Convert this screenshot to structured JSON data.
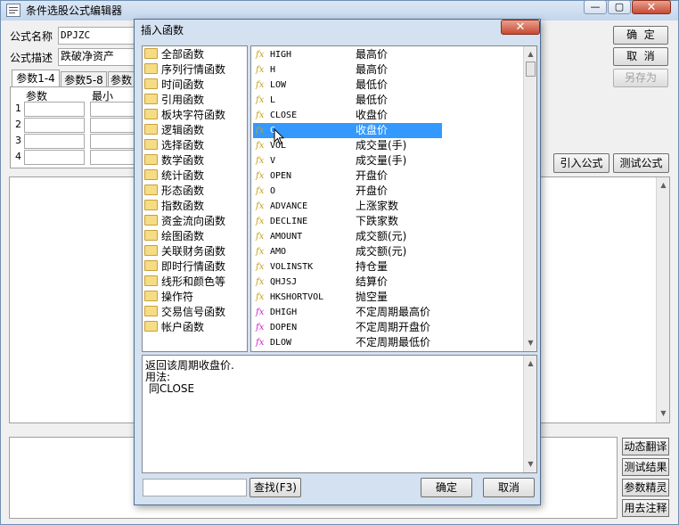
{
  "main_window": {
    "title": "条件选股公式编辑器",
    "formula_name_label": "公式名称",
    "formula_name_value": "DPJZC",
    "formula_desc_label": "公式描述",
    "formula_desc_value": "跌破净资产",
    "tabs": [
      "参数1-4",
      "参数5-8",
      "参数"
    ],
    "param_header": "参数",
    "min_header": "最小",
    "row_numbers": [
      "1",
      "2",
      "3",
      "4"
    ],
    "confirm_label": "确  定",
    "cancel_label": "取  消",
    "save_as_label": "另存为",
    "import_formula_label": "引入公式",
    "test_formula_label": "测试公式",
    "dynamic_translate_label": "动态翻译",
    "test_result_label": "测试结果",
    "param_wizard_label": "参数精灵",
    "remove_comment_label": "用去注释"
  },
  "dialog": {
    "title": "插入函数",
    "categories": [
      "全部函数",
      "序列行情函数",
      "时间函数",
      "引用函数",
      "板块字符函数",
      "逻辑函数",
      "选择函数",
      "数学函数",
      "统计函数",
      "形态函数",
      "指数函数",
      "资金流向函数",
      "绘图函数",
      "关联财务函数",
      "即时行情函数",
      "线形和颜色等",
      "操作符",
      "交易信号函数",
      "帐户函数"
    ],
    "functions": [
      {
        "name": "HIGH",
        "desc": "最高价",
        "icon": "fx"
      },
      {
        "name": "H",
        "desc": "最高价",
        "icon": "fx"
      },
      {
        "name": "LOW",
        "desc": "最低价",
        "icon": "fx"
      },
      {
        "name": "L",
        "desc": "最低价",
        "icon": "fx"
      },
      {
        "name": "CLOSE",
        "desc": "收盘价",
        "icon": "fx"
      },
      {
        "name": "C",
        "desc": "收盘价",
        "icon": "fx"
      },
      {
        "name": "VOL",
        "desc": "成交量(手)",
        "icon": "fx"
      },
      {
        "name": "V",
        "desc": "成交量(手)",
        "icon": "fx"
      },
      {
        "name": "OPEN",
        "desc": "开盘价",
        "icon": "fx"
      },
      {
        "name": "O",
        "desc": "开盘价",
        "icon": "fx"
      },
      {
        "name": "ADVANCE",
        "desc": "上涨家数",
        "icon": "fx"
      },
      {
        "name": "DECLINE",
        "desc": "下跌家数",
        "icon": "fx"
      },
      {
        "name": "AMOUNT",
        "desc": "成交额(元)",
        "icon": "fx"
      },
      {
        "name": "AMO",
        "desc": "成交额(元)",
        "icon": "fx"
      },
      {
        "name": "VOLINSTK",
        "desc": "持仓量",
        "icon": "fx"
      },
      {
        "name": "QHJSJ",
        "desc": "结算价",
        "icon": "fx"
      },
      {
        "name": "HKSHORTVOL",
        "desc": "抛空量",
        "icon": "fx"
      },
      {
        "name": "DHIGH",
        "desc": "不定周期最高价",
        "icon": "fx-pink"
      },
      {
        "name": "DOPEN",
        "desc": "不定周期开盘价",
        "icon": "fx-pink"
      },
      {
        "name": "DLOW",
        "desc": "不定周期最低价",
        "icon": "fx-pink"
      }
    ],
    "selected_function": "C",
    "description_lines": [
      "返回该周期收盘价.",
      "用法:",
      " 同CLOSE"
    ],
    "search_placeholder": "",
    "search_button": "查找(F3)",
    "ok_button": "确定",
    "cancel_button": "取消"
  },
  "colors": {
    "selection": "#3399ff",
    "fx_icon": "#c8a014",
    "fx_icon_alt": "#d020d0"
  }
}
